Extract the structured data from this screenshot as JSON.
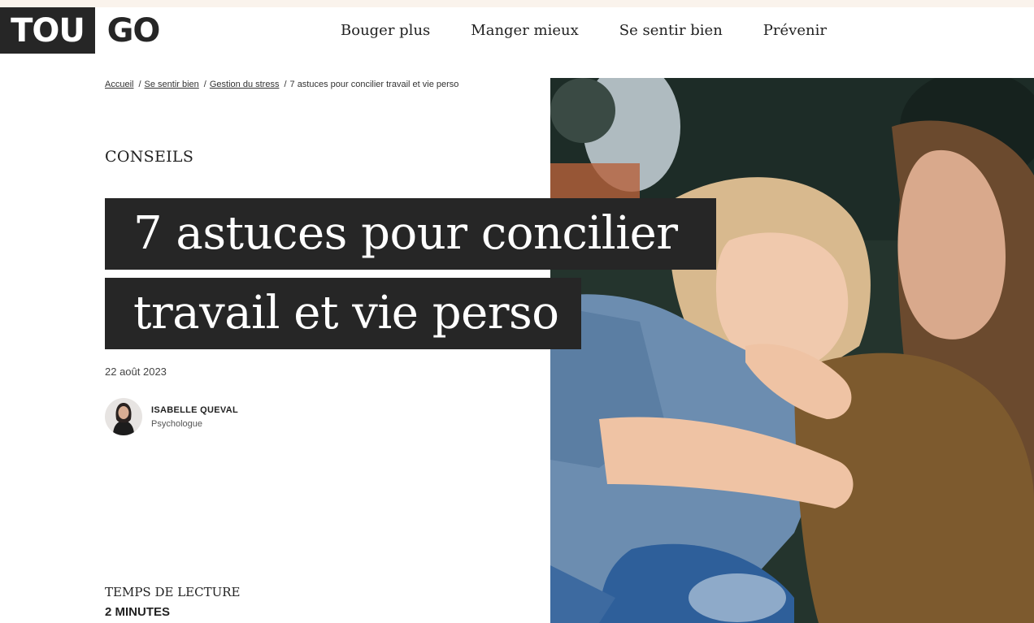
{
  "brand": {
    "logo_part1": "TOU",
    "logo_part2": "GO"
  },
  "nav": {
    "items": [
      "Bouger plus",
      "Manger mieux",
      "Se sentir bien",
      "Prévenir"
    ]
  },
  "breadcrumb": {
    "items": [
      "Accueil",
      "Se sentir bien",
      "Gestion du stress"
    ],
    "current": "7 astuces pour concilier travail et vie perso",
    "separator": "/"
  },
  "article": {
    "category": "CONSEILS",
    "title_line1": "7 astuces pour concilier",
    "title_line2": "travail et vie perso",
    "date": "22 août 2023",
    "author": {
      "name": "ISABELLE QUEVAL",
      "role": "Psychologue"
    },
    "reading_time_label": "TEMPS DE LECTURE",
    "reading_time_value": "2 MINUTES"
  },
  "colors": {
    "dark": "#262626",
    "top_strip": "#faf3ec",
    "background": "#ffffff"
  }
}
